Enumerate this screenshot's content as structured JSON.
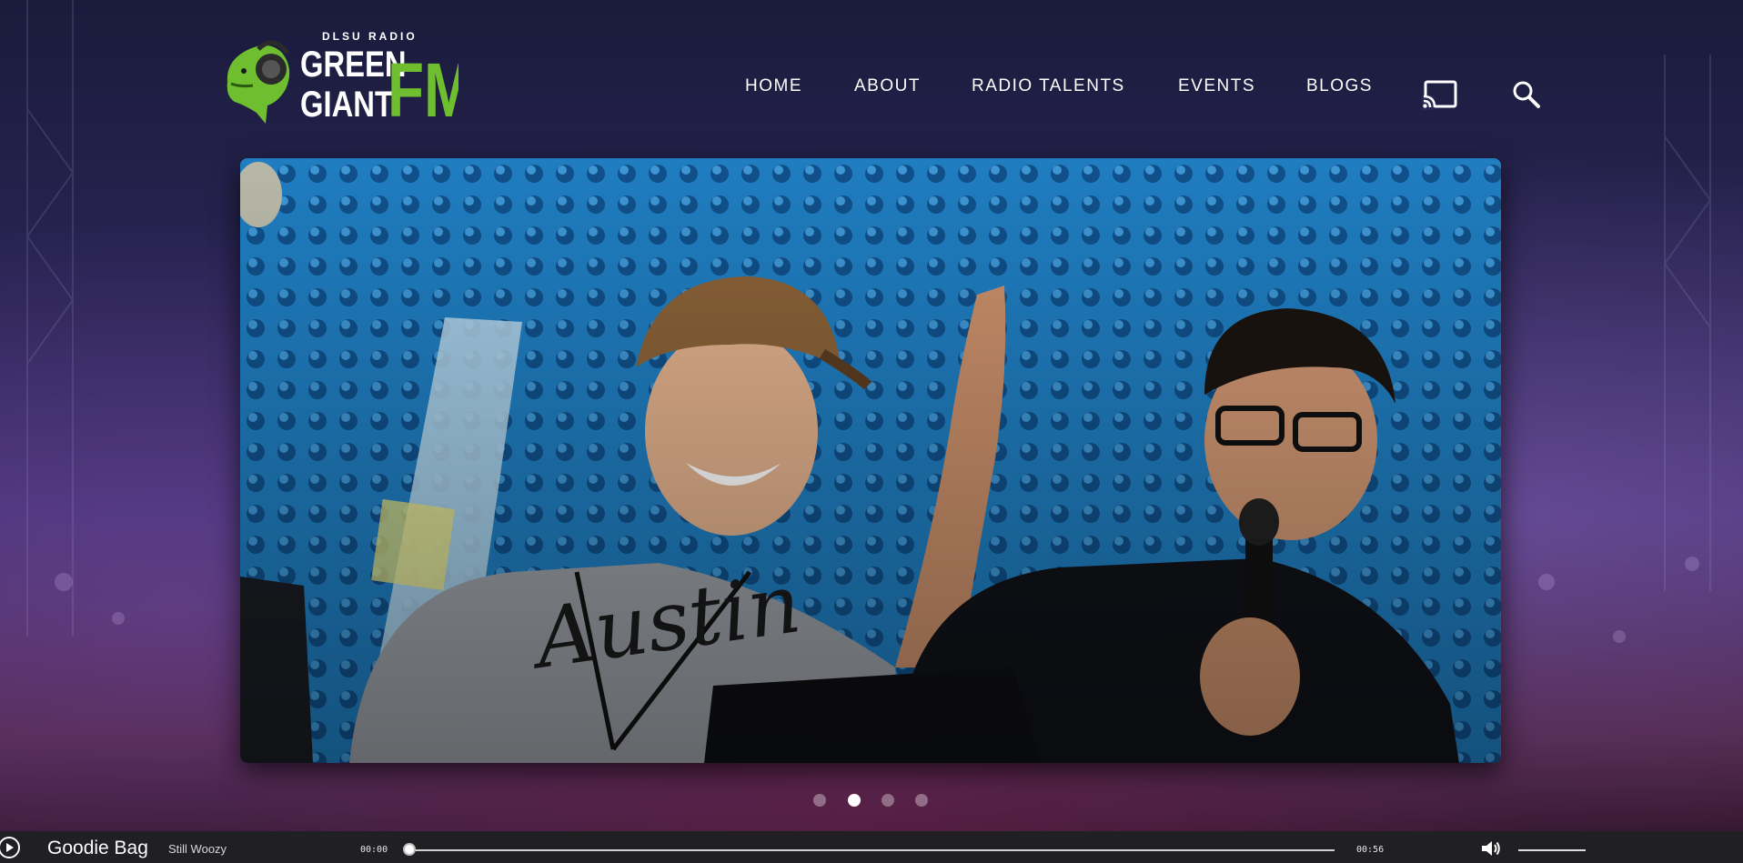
{
  "logo": {
    "top_text": "DLSU RADIO",
    "line1": "GREEN",
    "line2": "GIANT",
    "suffix": "FM",
    "brand_green": "#6fbe30"
  },
  "nav": {
    "items": [
      "HOME",
      "ABOUT",
      "RADIO TALENTS",
      "EVENTS",
      "BLOGS"
    ],
    "cast_icon": "cast-icon",
    "search_icon": "search-icon"
  },
  "carousel": {
    "slide_count": 4,
    "active_index": 1
  },
  "player": {
    "track_title": "Goodie Bag",
    "artist": "Still Woozy",
    "current_time": "00:00",
    "duration": "00:56",
    "progress": 0,
    "play_icon": "play-icon",
    "volume_icon": "volume-icon"
  },
  "colors": {
    "player_bg": "#1f1f24",
    "accent": "#6fbe30"
  }
}
